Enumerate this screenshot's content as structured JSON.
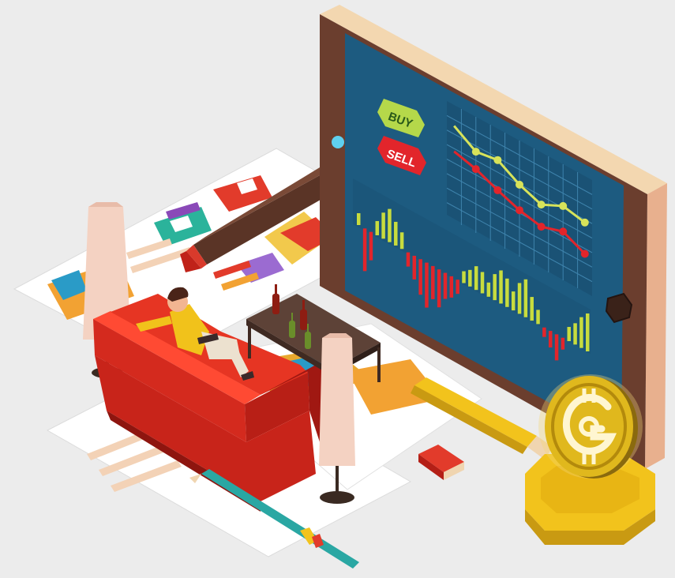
{
  "tablet": {
    "buy_label": "BUY",
    "sell_label": "SELL",
    "line_chart": {
      "series": [
        {
          "color": "#d7e35a",
          "values": [
            0.82,
            0.7,
            0.73,
            0.62,
            0.55,
            0.64,
            0.6
          ]
        },
        {
          "color": "#e2252b",
          "values": [
            0.6,
            0.55,
            0.47,
            0.4,
            0.36,
            0.42,
            0.33
          ]
        }
      ]
    },
    "volume_bars": [
      0.25,
      -0.9,
      -0.6,
      0.3,
      0.55,
      0.7,
      0.5,
      0.35,
      -0.3,
      -0.5,
      -0.75,
      -0.95,
      -0.7,
      -0.8,
      -0.55,
      -0.45,
      -0.3,
      0.25,
      0.35,
      0.5,
      0.45,
      0.3,
      0.55,
      0.7,
      0.6,
      0.4,
      0.65,
      0.8,
      0.5,
      0.3,
      -0.2,
      -0.35,
      -0.55,
      -0.25,
      0.3,
      0.45,
      0.65,
      0.8
    ]
  },
  "colors": {
    "background": "#ececec",
    "screen": "#1d5b80",
    "tablet_frame": "#6b3e2e",
    "sofa": "#d42a1e",
    "coin": "#e0b81d"
  },
  "icons": {
    "coin": "crypto-coin-g-icon",
    "home": "tablet-home-button-icon"
  }
}
